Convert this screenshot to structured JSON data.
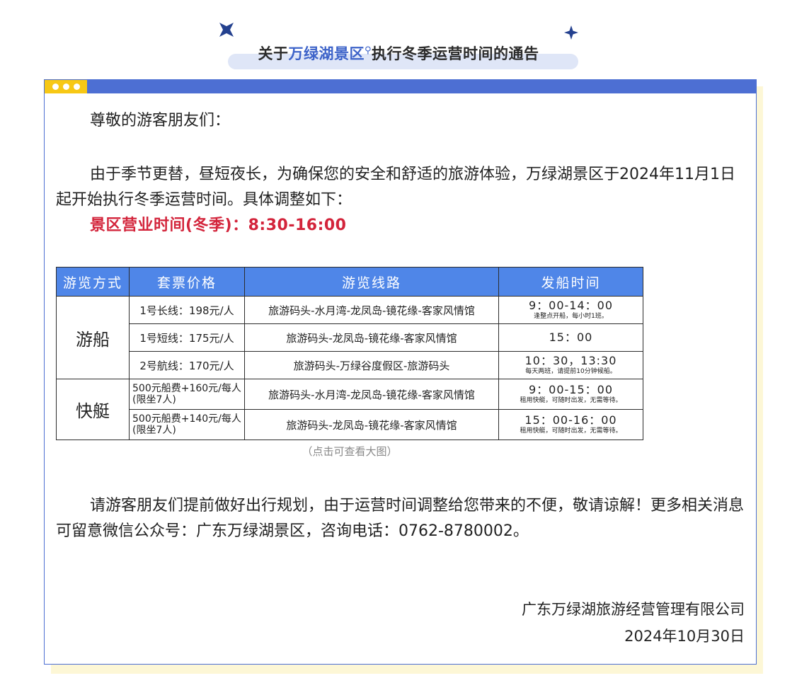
{
  "header": {
    "title_prefix": "关于",
    "title_highlight": "万绿湖景区",
    "title_suffix": "执行冬季运营时间的通告",
    "accent_color": "#3d63c9"
  },
  "notice": {
    "greeting": "尊敬的游客朋友们：",
    "paragraph1": "由于季节更替，昼短夜长，为确保您的安全和舒适的旅游体验，万绿湖景区于2024年11月1日起开始执行冬季运营时间。具体调整如下：",
    "hours": "景区营业时间(冬季)：8:30-16:00",
    "paragraph2": "请游客朋友们提前做好出行规划，由于运营时间调整给您带来的不便，敬请谅解！更多相关消息可留意微信公众号：广东万绿湖景区，咨询电话：0762-8780002。",
    "signature_company": "广东万绿湖旅游经营管理有限公司",
    "signature_date": "2024年10月30日"
  },
  "table": {
    "headers": [
      "游览方式",
      "套票价格",
      "游览线路",
      "发船时间"
    ],
    "mode_boat": "游船",
    "mode_speedboat": "快艇",
    "rows": [
      {
        "price": "1号长线：198元/人",
        "route": "旅游码头-水月湾-龙凤岛-镜花缘-客家风情馆",
        "time": "9：00-14：00",
        "note": "逢整点开船，每小时1班。"
      },
      {
        "price": "1号短线：175元/人",
        "route": "旅游码头-龙凤岛-镜花缘-客家风情馆",
        "time": "15：00",
        "note": ""
      },
      {
        "price": "2号航线：170元/人",
        "route": "旅游码头-万绿谷度假区-旅游码头",
        "time": "10：30，13:30",
        "note": "每天两班，请提前10分钟候船。"
      },
      {
        "price_line1": "500元船费+160元/每人",
        "price_line2": "(限坐7人)",
        "route": "旅游码头-水月湾-龙凤岛-镜花缘-客家风情馆",
        "time": "9：00-15：00",
        "note": "租用快艇，可随时出发，无需等待。"
      },
      {
        "price_line1": "500元船费+140元/每人",
        "price_line2": "(限坐7人)",
        "route": "旅游码头-龙凤岛-镜花缘-客家风情馆",
        "time": "15：00-16：00",
        "note": "租用快艇，可随时出发，无需等待。"
      }
    ],
    "caption": "（点击可查看大图）"
  }
}
